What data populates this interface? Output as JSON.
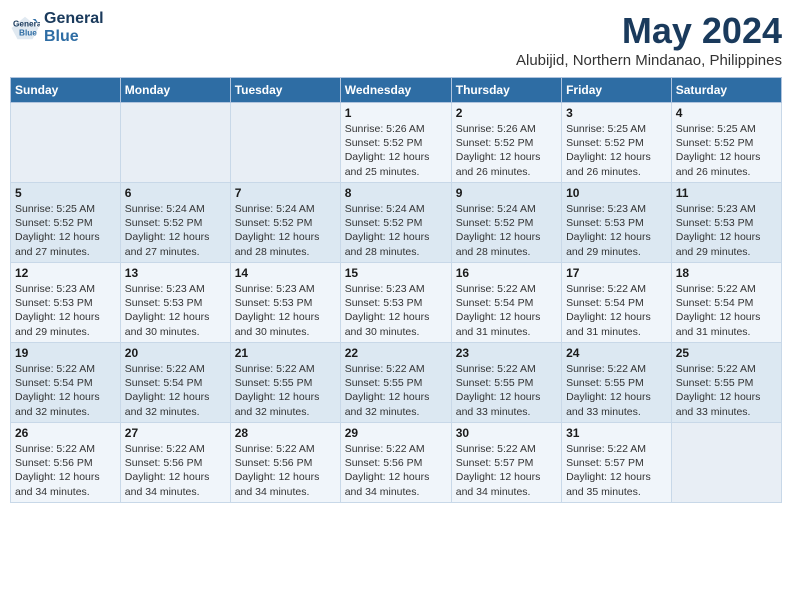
{
  "logo": {
    "line1": "General",
    "line2": "Blue"
  },
  "title": "May 2024",
  "subtitle": "Alubijid, Northern Mindanao, Philippines",
  "days_header": [
    "Sunday",
    "Monday",
    "Tuesday",
    "Wednesday",
    "Thursday",
    "Friday",
    "Saturday"
  ],
  "weeks": [
    [
      {
        "day": "",
        "info": ""
      },
      {
        "day": "",
        "info": ""
      },
      {
        "day": "",
        "info": ""
      },
      {
        "day": "1",
        "info": "Sunrise: 5:26 AM\nSunset: 5:52 PM\nDaylight: 12 hours\nand 25 minutes."
      },
      {
        "day": "2",
        "info": "Sunrise: 5:26 AM\nSunset: 5:52 PM\nDaylight: 12 hours\nand 26 minutes."
      },
      {
        "day": "3",
        "info": "Sunrise: 5:25 AM\nSunset: 5:52 PM\nDaylight: 12 hours\nand 26 minutes."
      },
      {
        "day": "4",
        "info": "Sunrise: 5:25 AM\nSunset: 5:52 PM\nDaylight: 12 hours\nand 26 minutes."
      }
    ],
    [
      {
        "day": "5",
        "info": "Sunrise: 5:25 AM\nSunset: 5:52 PM\nDaylight: 12 hours\nand 27 minutes."
      },
      {
        "day": "6",
        "info": "Sunrise: 5:24 AM\nSunset: 5:52 PM\nDaylight: 12 hours\nand 27 minutes."
      },
      {
        "day": "7",
        "info": "Sunrise: 5:24 AM\nSunset: 5:52 PM\nDaylight: 12 hours\nand 28 minutes."
      },
      {
        "day": "8",
        "info": "Sunrise: 5:24 AM\nSunset: 5:52 PM\nDaylight: 12 hours\nand 28 minutes."
      },
      {
        "day": "9",
        "info": "Sunrise: 5:24 AM\nSunset: 5:52 PM\nDaylight: 12 hours\nand 28 minutes."
      },
      {
        "day": "10",
        "info": "Sunrise: 5:23 AM\nSunset: 5:53 PM\nDaylight: 12 hours\nand 29 minutes."
      },
      {
        "day": "11",
        "info": "Sunrise: 5:23 AM\nSunset: 5:53 PM\nDaylight: 12 hours\nand 29 minutes."
      }
    ],
    [
      {
        "day": "12",
        "info": "Sunrise: 5:23 AM\nSunset: 5:53 PM\nDaylight: 12 hours\nand 29 minutes."
      },
      {
        "day": "13",
        "info": "Sunrise: 5:23 AM\nSunset: 5:53 PM\nDaylight: 12 hours\nand 30 minutes."
      },
      {
        "day": "14",
        "info": "Sunrise: 5:23 AM\nSunset: 5:53 PM\nDaylight: 12 hours\nand 30 minutes."
      },
      {
        "day": "15",
        "info": "Sunrise: 5:23 AM\nSunset: 5:53 PM\nDaylight: 12 hours\nand 30 minutes."
      },
      {
        "day": "16",
        "info": "Sunrise: 5:22 AM\nSunset: 5:54 PM\nDaylight: 12 hours\nand 31 minutes."
      },
      {
        "day": "17",
        "info": "Sunrise: 5:22 AM\nSunset: 5:54 PM\nDaylight: 12 hours\nand 31 minutes."
      },
      {
        "day": "18",
        "info": "Sunrise: 5:22 AM\nSunset: 5:54 PM\nDaylight: 12 hours\nand 31 minutes."
      }
    ],
    [
      {
        "day": "19",
        "info": "Sunrise: 5:22 AM\nSunset: 5:54 PM\nDaylight: 12 hours\nand 32 minutes."
      },
      {
        "day": "20",
        "info": "Sunrise: 5:22 AM\nSunset: 5:54 PM\nDaylight: 12 hours\nand 32 minutes."
      },
      {
        "day": "21",
        "info": "Sunrise: 5:22 AM\nSunset: 5:55 PM\nDaylight: 12 hours\nand 32 minutes."
      },
      {
        "day": "22",
        "info": "Sunrise: 5:22 AM\nSunset: 5:55 PM\nDaylight: 12 hours\nand 32 minutes."
      },
      {
        "day": "23",
        "info": "Sunrise: 5:22 AM\nSunset: 5:55 PM\nDaylight: 12 hours\nand 33 minutes."
      },
      {
        "day": "24",
        "info": "Sunrise: 5:22 AM\nSunset: 5:55 PM\nDaylight: 12 hours\nand 33 minutes."
      },
      {
        "day": "25",
        "info": "Sunrise: 5:22 AM\nSunset: 5:55 PM\nDaylight: 12 hours\nand 33 minutes."
      }
    ],
    [
      {
        "day": "26",
        "info": "Sunrise: 5:22 AM\nSunset: 5:56 PM\nDaylight: 12 hours\nand 34 minutes."
      },
      {
        "day": "27",
        "info": "Sunrise: 5:22 AM\nSunset: 5:56 PM\nDaylight: 12 hours\nand 34 minutes."
      },
      {
        "day": "28",
        "info": "Sunrise: 5:22 AM\nSunset: 5:56 PM\nDaylight: 12 hours\nand 34 minutes."
      },
      {
        "day": "29",
        "info": "Sunrise: 5:22 AM\nSunset: 5:56 PM\nDaylight: 12 hours\nand 34 minutes."
      },
      {
        "day": "30",
        "info": "Sunrise: 5:22 AM\nSunset: 5:57 PM\nDaylight: 12 hours\nand 34 minutes."
      },
      {
        "day": "31",
        "info": "Sunrise: 5:22 AM\nSunset: 5:57 PM\nDaylight: 12 hours\nand 35 minutes."
      },
      {
        "day": "",
        "info": ""
      }
    ]
  ]
}
